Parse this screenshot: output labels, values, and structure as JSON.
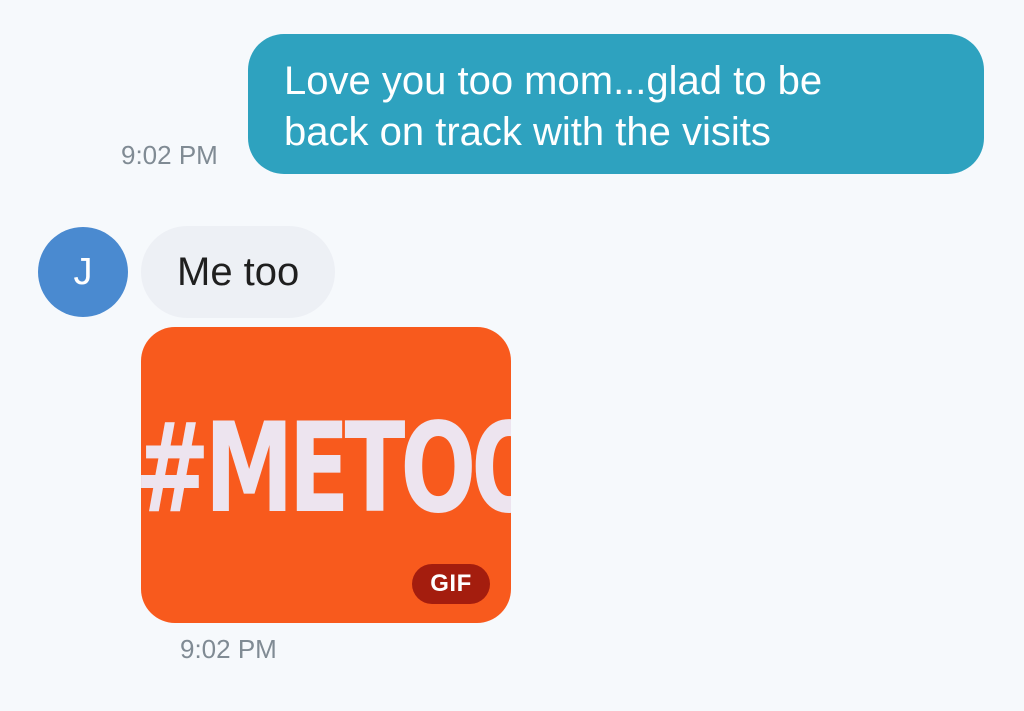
{
  "conversation": {
    "outgoing": {
      "text_line1": "Love you too mom...glad to be",
      "text_line2": "back on track with the visits",
      "timestamp": "9:02 PM"
    },
    "incoming": {
      "avatar_initial": "J",
      "text": "Me too",
      "gif": {
        "label": "#METOO",
        "badge": "GIF"
      },
      "timestamp": "9:02 PM"
    }
  },
  "colors": {
    "background": "#f6f9fc",
    "outgoing_bubble": "#2ea2bf",
    "incoming_bubble": "#edf0f5",
    "avatar": "#4a8ad0",
    "gif_background": "#f85a1d",
    "gif_badge": "#a41d0e",
    "timestamp_text": "#808b94"
  },
  "icons": {
    "avatar": "contact-initial-avatar"
  }
}
